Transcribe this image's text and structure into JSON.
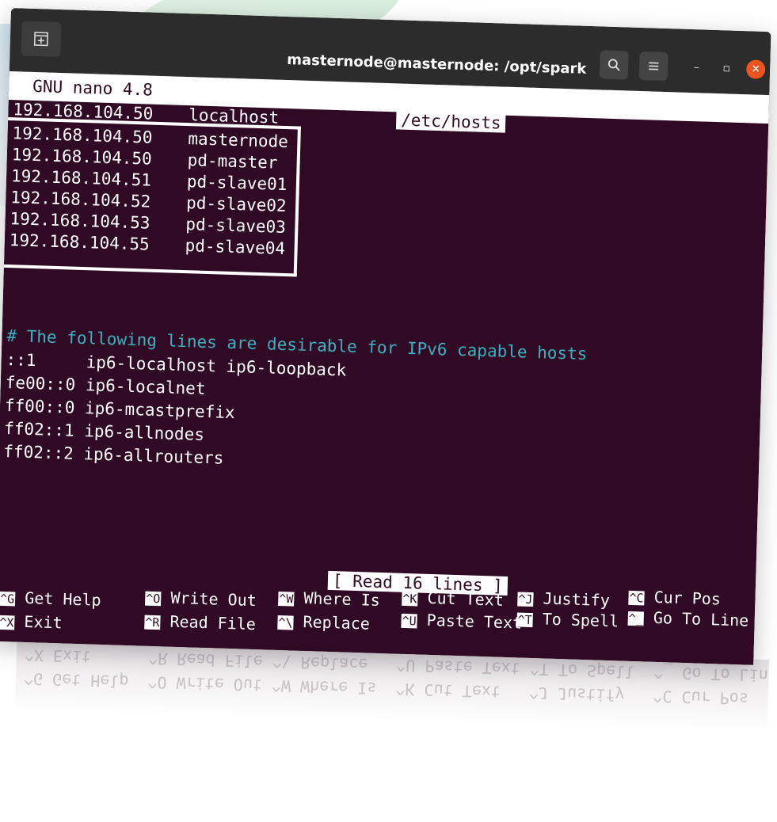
{
  "window": {
    "title": "masternode@masternode: /opt/spark",
    "new_tab_icon": "new-tab-icon",
    "search_icon": "search-icon",
    "menu_icon": "hamburger-menu-icon",
    "minimize_label": "–",
    "maximize_label": "▫",
    "close_label": "✕"
  },
  "nano": {
    "version": "GNU nano 4.8",
    "filename": "/etc/hosts",
    "status": "[ Read 16 lines ]"
  },
  "hosts": [
    {
      "ip": "192.168.104.50",
      "name": "localhost"
    },
    {
      "ip": "192.168.104.50",
      "name": "masternode"
    },
    {
      "ip": "192.168.104.50",
      "name": "pd-master"
    },
    {
      "ip": "192.168.104.51",
      "name": "pd-slave01"
    },
    {
      "ip": "192.168.104.52",
      "name": "pd-slave02"
    },
    {
      "ip": "192.168.104.53",
      "name": "pd-slave03"
    },
    {
      "ip": "192.168.104.55",
      "name": "pd-slave04"
    }
  ],
  "comment": "# The following lines are desirable for IPv6 capable hosts",
  "ipv6": [
    "::1     ip6-localhost ip6-loopback",
    "fe00::0 ip6-localnet",
    "ff00::0 ip6-mcastprefix",
    "ff02::1 ip6-allnodes",
    "ff02::2 ip6-allrouters"
  ],
  "shortcuts": [
    {
      "key": "^G",
      "label": "Get Help"
    },
    {
      "key": "^X",
      "label": "Exit"
    },
    {
      "key": "^O",
      "label": "Write Out"
    },
    {
      "key": "^R",
      "label": "Read File"
    },
    {
      "key": "^W",
      "label": "Where Is"
    },
    {
      "key": "^\\",
      "label": "Replace"
    },
    {
      "key": "^K",
      "label": "Cut Text"
    },
    {
      "key": "^U",
      "label": "Paste Text"
    },
    {
      "key": "^J",
      "label": "Justify"
    },
    {
      "key": "^T",
      "label": "To Spell"
    },
    {
      "key": "^C",
      "label": "Cur Pos"
    },
    {
      "key": "^_",
      "label": "Go To Line"
    }
  ],
  "colors": {
    "terminal_bg": "#300a24",
    "comment": "#3dafc0",
    "close_button": "#e95420"
  }
}
